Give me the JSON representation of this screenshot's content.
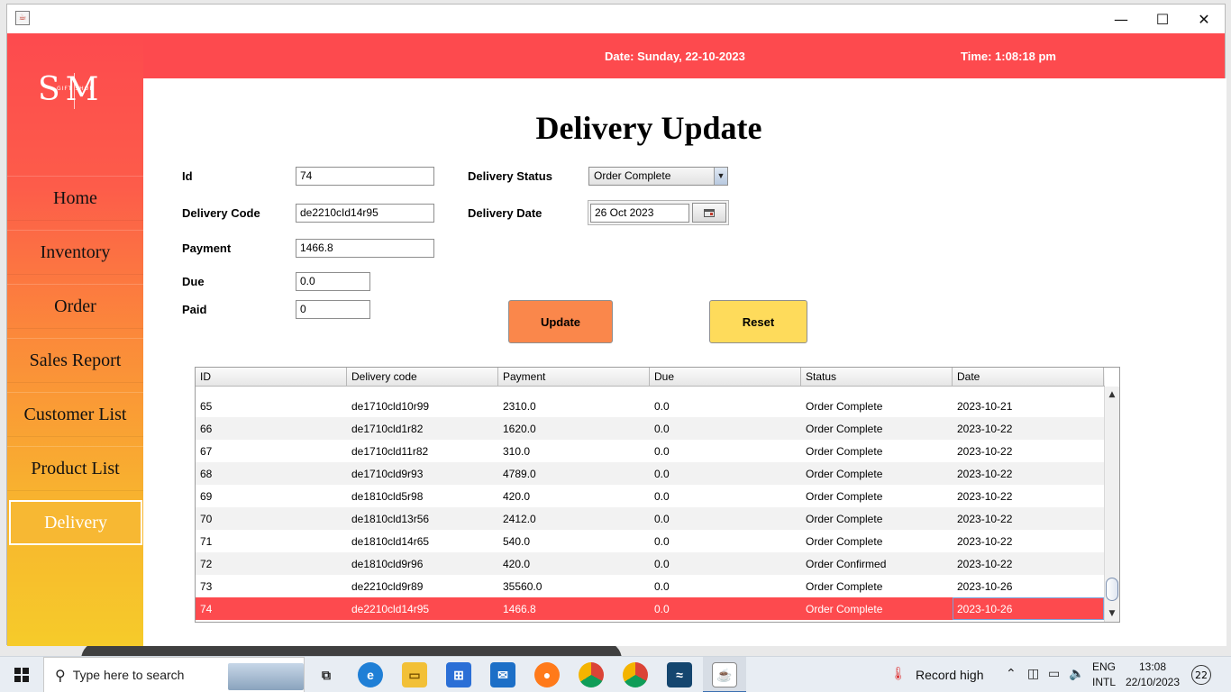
{
  "window": {
    "controls": {
      "minimize": "—",
      "maximize": "☐",
      "close": "✕"
    }
  },
  "header": {
    "date": "Date: Sunday, 22-10-2023",
    "time": "Time: 1:08:18 pm"
  },
  "logo": {
    "initials": "SM",
    "subtitle": "GIFT SHOP"
  },
  "sidebar": {
    "items": [
      {
        "label": "Home"
      },
      {
        "label": "Inventory"
      },
      {
        "label": "Order"
      },
      {
        "label": "Sales Report"
      },
      {
        "label": "Customer List"
      },
      {
        "label": "Product List"
      },
      {
        "label": "Delivery"
      }
    ],
    "active": "Delivery"
  },
  "form": {
    "title": "Delivery Update",
    "id_label": "Id",
    "id_value": "74",
    "code_label": "Delivery Code",
    "code_value": "de2210cId14r95",
    "payment_label": "Payment",
    "payment_value": "1466.8",
    "due_label": "Due",
    "due_value": "0.0",
    "paid_label": "Paid",
    "paid_value": "0",
    "status_label": "Delivery Status",
    "status_value": "Order Complete",
    "date_label": "Delivery Date",
    "date_value": "26 Oct 2023",
    "update_label": "Update",
    "reset_label": "Reset"
  },
  "table": {
    "columns": [
      "ID",
      "Delivery code",
      "Payment",
      "Due",
      "Status",
      "Date"
    ],
    "rows": [
      [
        "65",
        "de1710cld10r99",
        "2310.0",
        "0.0",
        "Order Complete",
        "2023-10-21"
      ],
      [
        "66",
        "de1710cld1r82",
        "1620.0",
        "0.0",
        "Order Complete",
        "2023-10-22"
      ],
      [
        "67",
        "de1710cld11r82",
        "310.0",
        "0.0",
        "Order Complete",
        "2023-10-22"
      ],
      [
        "68",
        "de1710cld9r93",
        "4789.0",
        "0.0",
        "Order Complete",
        "2023-10-22"
      ],
      [
        "69",
        "de1810cld5r98",
        "420.0",
        "0.0",
        "Order Complete",
        "2023-10-22"
      ],
      [
        "70",
        "de1810cld13r56",
        "2412.0",
        "0.0",
        "Order Complete",
        "2023-10-22"
      ],
      [
        "71",
        "de1810cld14r65",
        "540.0",
        "0.0",
        "Order Complete",
        "2023-10-22"
      ],
      [
        "72",
        "de1810cld9r96",
        "420.0",
        "0.0",
        "Order Confirmed",
        "2023-10-22"
      ],
      [
        "73",
        "de2210cld9r89",
        "35560.0",
        "0.0",
        "Order Complete",
        "2023-10-26"
      ],
      [
        "74",
        "de2210cld14r95",
        "1466.8",
        "0.0",
        "Order Complete",
        "2023-10-26"
      ]
    ],
    "selected_id": "74",
    "colors": {
      "selected_row": "#fd4a4e"
    }
  },
  "taskbar": {
    "search_placeholder": "Type here to search",
    "weather": "Record high",
    "lang_top": "ENG",
    "lang_bottom": "INTL",
    "clock_time": "13:08",
    "clock_date": "22/10/2023",
    "notification_count": "22"
  },
  "colors": {
    "accent_red": "#fd4a4e",
    "update_button": "#fa874b",
    "reset_button": "#fedb5b"
  }
}
